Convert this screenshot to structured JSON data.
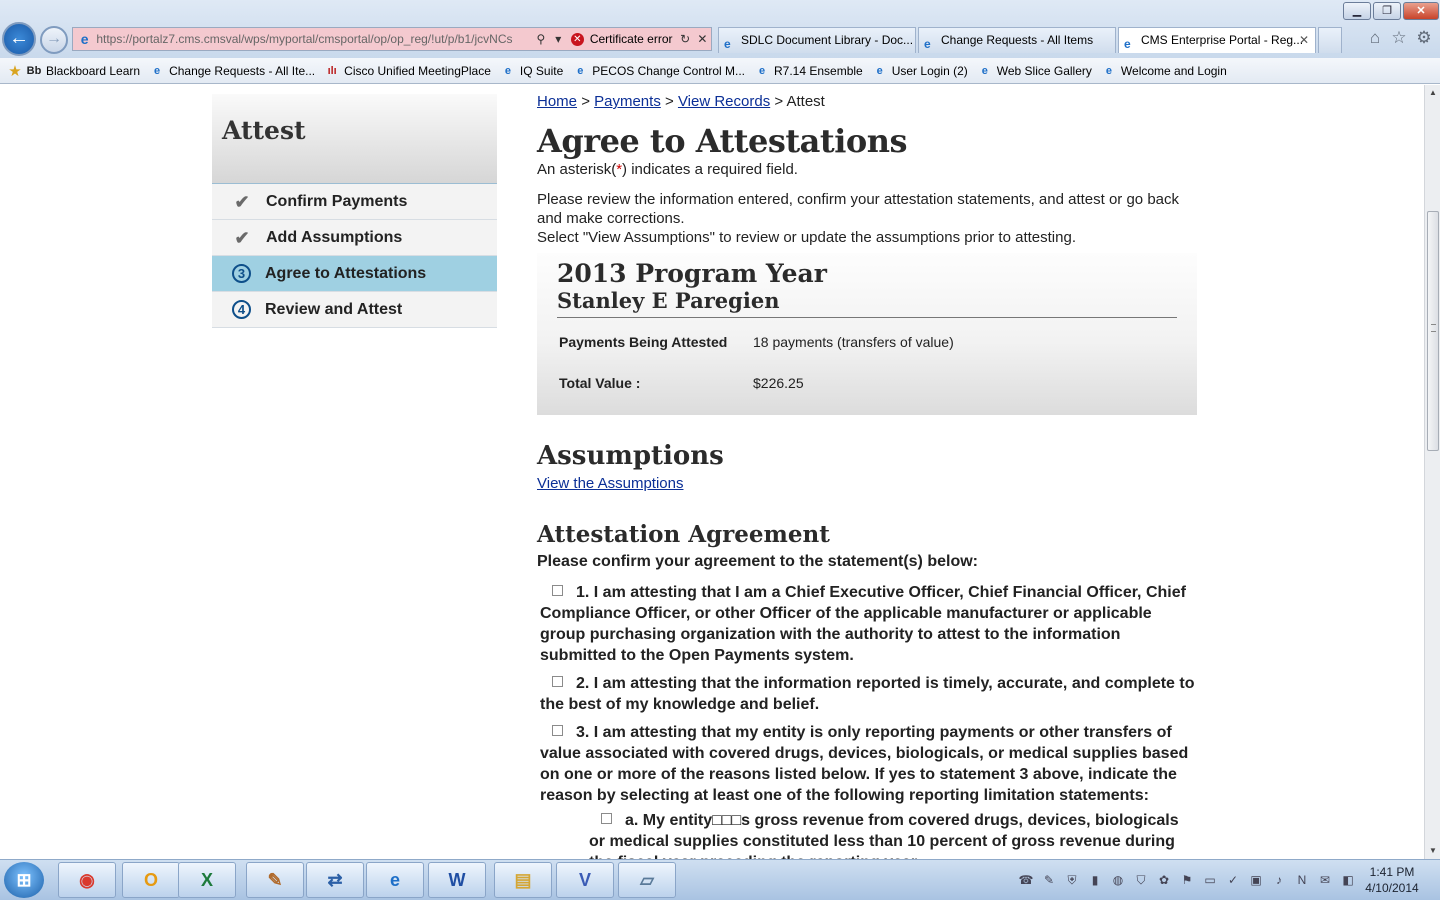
{
  "browser": {
    "address_url": "https://portalz7.cms.cmsval/wps/myportal/cmsportal/op/op_reg/!ut/p/b1/jcvNCs",
    "cert_error": "Certificate error",
    "tabs": [
      {
        "label": "SDLC Document Library - Doc..."
      },
      {
        "label": "Change Requests - All Items"
      },
      {
        "label": "CMS Enterprise Portal - Reg..."
      }
    ],
    "favorites": [
      {
        "label": "Blackboard Learn",
        "icon": "bb"
      },
      {
        "label": "Change Requests - All Ite...",
        "icon": "e"
      },
      {
        "label": "Cisco Unified MeetingPlace",
        "icon": "cisco"
      },
      {
        "label": "IQ Suite",
        "icon": "e"
      },
      {
        "label": "PECOS Change Control M...",
        "icon": "e"
      },
      {
        "label": "R7.14 Ensemble",
        "icon": "e"
      },
      {
        "label": "User Login (2)",
        "icon": "e"
      },
      {
        "label": "Web Slice Gallery",
        "icon": "e"
      },
      {
        "label": "Welcome and Login",
        "icon": "e"
      }
    ]
  },
  "sidebar": {
    "title": "Attest",
    "steps": [
      {
        "label": "Confirm Payments",
        "state": "done",
        "marker": "✔"
      },
      {
        "label": "Add Assumptions",
        "state": "done",
        "marker": "✔"
      },
      {
        "label": "Agree to Attestations",
        "state": "active",
        "marker": "3"
      },
      {
        "label": "Review and Attest",
        "state": "pending",
        "marker": "4"
      }
    ]
  },
  "breadcrumb": {
    "home": "Home",
    "payments": "Payments",
    "view_records": "View Records",
    "current": "Attest",
    "sep": ">"
  },
  "page": {
    "title": "Agree to Attestations",
    "required_note_pre": "An asterisk(",
    "required_note_ast": "*",
    "required_note_post": ") indicates a required field.",
    "intro_1": "Please review the information entered, confirm your attestation statements, and attest or go back and make corrections.",
    "intro_2": "Select \"View Assumptions\" to review or update the assumptions prior to attesting."
  },
  "summary": {
    "program_year": "2013 Program Year",
    "name": "Stanley E Paregien",
    "payments_label": "Payments Being Attested",
    "payments_value": "18 payments (transfers of value)",
    "total_label": "Total Value :",
    "total_value": "$226.25"
  },
  "assumptions": {
    "title": "Assumptions",
    "link": "View the Assumptions"
  },
  "attestation": {
    "title": "Attestation Agreement",
    "prompt": "Please confirm your agreement to the statement(s) below:",
    "statements": [
      "1. I am attesting that I am a Chief Executive Officer, Chief Financial Officer, Chief Compliance Officer, or other Officer of the applicable manufacturer or applicable group purchasing organization with the authority to attest to the information submitted to the Open Payments system.",
      "2. I am attesting that the information reported is timely, accurate, and complete to the best of my knowledge and belief.",
      "3. I am attesting that my entity is only reporting payments or other transfers of value associated with covered drugs, devices, biologicals, or medical supplies based on one or more of the reasons listed below. If yes to statement 3 above, indicate the reason by selecting at least one of the following reporting limitation statements:",
      "a. My entity□□□s gross revenue from covered drugs, devices, biologicals or medical supplies constituted less than 10 percent of gross revenue during the fiscal year preceding the reporting year."
    ]
  },
  "taskbar": {
    "time": "1:41 PM",
    "date": "4/10/2014",
    "apps": [
      "chrome",
      "outlook",
      "excel",
      "paint",
      "remote",
      "ie",
      "word",
      "explorer",
      "visio",
      "notes"
    ]
  }
}
